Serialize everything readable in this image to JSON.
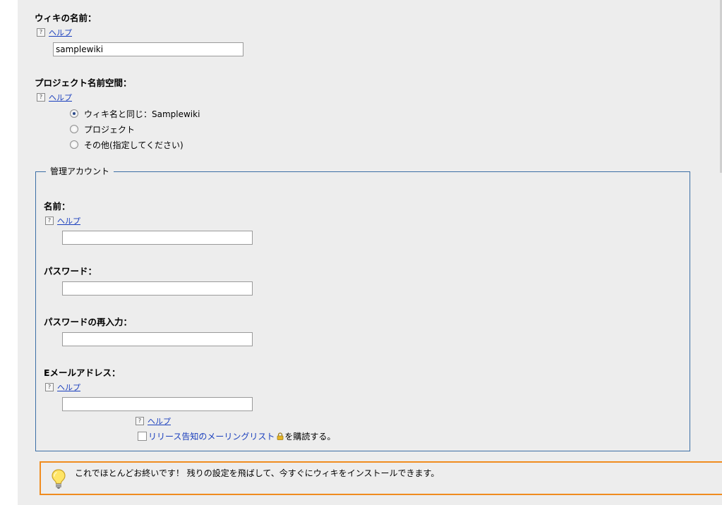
{
  "wiki_name": {
    "label": "ウィキの名前：",
    "help": "ヘルプ",
    "value": "samplewiki"
  },
  "namespace": {
    "label": "プロジェクト名前空間：",
    "help": "ヘルプ",
    "options": [
      {
        "label": "ウィキ名と同じ：Samplewiki",
        "selected": true
      },
      {
        "label": "プロジェクト",
        "selected": false
      },
      {
        "label": "その他(指定してください)",
        "selected": false
      }
    ]
  },
  "admin": {
    "legend": "管理アカウント",
    "name_label": "名前：",
    "name_help": "ヘルプ",
    "name_value": "",
    "password_label": "パスワード：",
    "password_value": "",
    "password2_label": "パスワードの再入力：",
    "password2_value": "",
    "email_label": "Eメールアドレス：",
    "email_help": "ヘルプ",
    "email_value": "",
    "subscribe_help": "ヘルプ",
    "subscribe_link": "リリース告知のメーリングリスト",
    "subscribe_suffix": "を購読する。",
    "subscribe_checked": false
  },
  "notice": {
    "text": "これでほとんどお終いです！ 残りの設定を飛ばして、今すぐにウィキをインストールできます。"
  },
  "icons": {
    "help": "question-box-icon",
    "bulb": "lightbulb-icon",
    "lock": "lock-icon"
  },
  "colors": {
    "accent_border": "#3b6ea5",
    "notice_border": "#f08c1f",
    "link": "#1a3fbd",
    "background": "#ededed"
  }
}
